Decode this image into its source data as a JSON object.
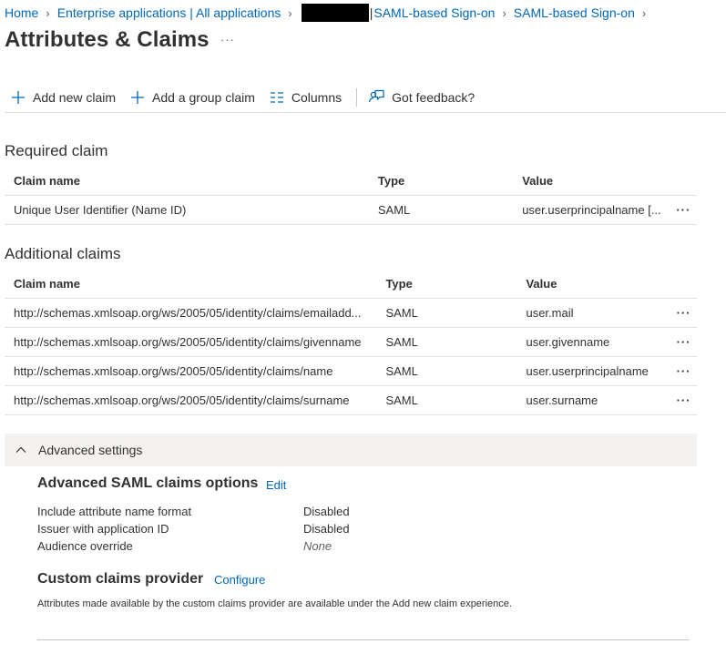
{
  "breadcrumb": {
    "home": "Home",
    "enterprise": "Enterprise applications | All applications",
    "pipe": "|",
    "saml1": "SAML-based Sign-on",
    "saml2": "SAML-based Sign-on"
  },
  "page": {
    "title": "Attributes & Claims",
    "more": "···"
  },
  "toolbar": {
    "add_claim": "Add new claim",
    "add_group_claim": "Add a group claim",
    "columns": "Columns",
    "feedback": "Got feedback?"
  },
  "required": {
    "title": "Required claim",
    "headers": {
      "name": "Claim name",
      "type": "Type",
      "value": "Value"
    },
    "rows": [
      {
        "name": "Unique User Identifier (Name ID)",
        "type": "SAML",
        "value": "user.userprincipalname [..."
      }
    ]
  },
  "additional": {
    "title": "Additional claims",
    "headers": {
      "name": "Claim name",
      "type": "Type",
      "value": "Value"
    },
    "rows": [
      {
        "name": "http://schemas.xmlsoap.org/ws/2005/05/identity/claims/emailadd...",
        "type": "SAML",
        "value": "user.mail"
      },
      {
        "name": "http://schemas.xmlsoap.org/ws/2005/05/identity/claims/givenname",
        "type": "SAML",
        "value": "user.givenname"
      },
      {
        "name": "http://schemas.xmlsoap.org/ws/2005/05/identity/claims/name",
        "type": "SAML",
        "value": "user.userprincipalname"
      },
      {
        "name": "http://schemas.xmlsoap.org/ws/2005/05/identity/claims/surname",
        "type": "SAML",
        "value": "user.surname"
      }
    ]
  },
  "row_more": "···",
  "advanced": {
    "header": "Advanced settings",
    "saml_options_title": "Advanced SAML claims options",
    "edit": "Edit",
    "settings": [
      {
        "label": "Include attribute name format",
        "value": "Disabled"
      },
      {
        "label": "Issuer with application ID",
        "value": "Disabled"
      },
      {
        "label": "Audience override",
        "value": "None"
      }
    ],
    "custom_provider_title": "Custom claims provider",
    "configure": "Configure",
    "note": "Attributes made available by the custom claims provider are available under the Add new claim experience."
  },
  "colors": {
    "link": "#0067b8",
    "text": "#323130",
    "section_bg": "#f3f2f1"
  }
}
